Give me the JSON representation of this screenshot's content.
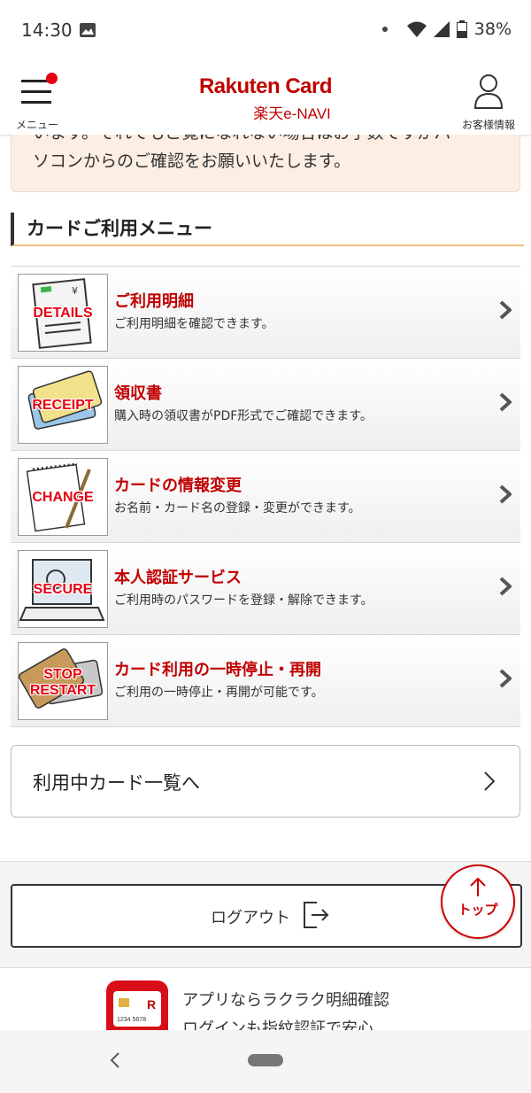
{
  "status_bar": {
    "time": "14:30",
    "battery": "38%"
  },
  "header": {
    "menu_label": "メニュー",
    "brand_main": "Rakuten Card",
    "brand_sub": "楽天e-NAVI",
    "account_label": "お客様情報"
  },
  "notice": {
    "line1": "います。それでもご覧になれない場合はお手数ですがパ",
    "line2": "ソコンからのご確認をお願いいたします。"
  },
  "section_title": "カードご利用メニュー",
  "menu_items": [
    {
      "thumb": "DETAILS",
      "title": "ご利用明細",
      "desc": "ご利用明細を確認できます。"
    },
    {
      "thumb": "RECEIPT",
      "title": "領収書",
      "desc": "購入時の領収書がPDF形式でご確認できます。"
    },
    {
      "thumb": "CHANGE",
      "title": "カードの情報変更",
      "desc": "お名前・カード名の登録・変更ができます。"
    },
    {
      "thumb": "SECURE",
      "title": "本人認証サービス",
      "desc": "ご利用時のパスワードを登録・解除できます。"
    },
    {
      "thumb": "STOP",
      "thumb2": "RESTART",
      "title": "カード利用の一時停止・再開",
      "desc": "ご利用の一時停止・再開が可能です。"
    }
  ],
  "card_list_button": "利用中カード一覧へ",
  "logout_button": "ログアウト",
  "top_button": "トップ",
  "app_promo": {
    "line1": "アプリならラクラク明細確認",
    "line2": "ログインも指紋認証で安心",
    "card_number": "1234 5678"
  },
  "colors": {
    "brand_red": "#bf0000",
    "title_red": "#c00000",
    "notice_bg": "#fdeee3"
  }
}
